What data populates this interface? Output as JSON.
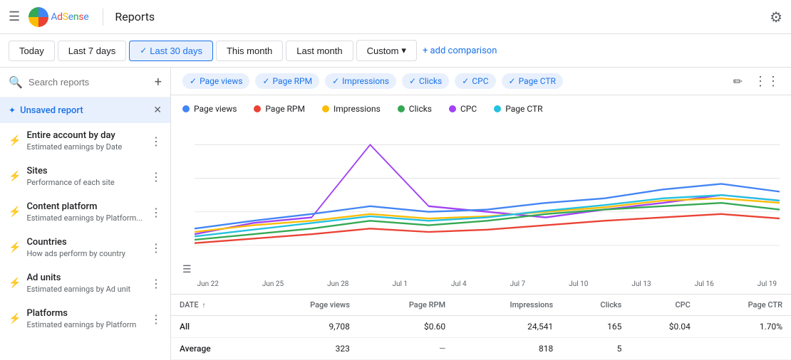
{
  "header": {
    "menu_icon": "☰",
    "logo_alt": "Google AdSense",
    "divider": true,
    "title": "Reports",
    "settings_icon": "⚙"
  },
  "date_bar": {
    "buttons": [
      {
        "label": "Today",
        "active": false
      },
      {
        "label": "Last 7 days",
        "active": false
      },
      {
        "label": "Last 30 days",
        "active": true
      },
      {
        "label": "This month",
        "active": false
      },
      {
        "label": "Last month",
        "active": false
      },
      {
        "label": "Custom",
        "active": false,
        "has_arrow": true
      }
    ],
    "add_comparison": "+ add comparison"
  },
  "sidebar": {
    "search_placeholder": "Search reports",
    "add_icon": "+",
    "unsaved_report": {
      "title": "Unsaved report",
      "close_icon": "✕"
    },
    "items": [
      {
        "id": "entire-account",
        "title": "Entire account by day",
        "subtitle": "Estimated earnings by Date",
        "has_menu": true,
        "active": false
      },
      {
        "id": "sites",
        "title": "Sites",
        "subtitle": "Performance of each site",
        "has_menu": true,
        "active": false
      },
      {
        "id": "content-platform",
        "title": "Content platform",
        "subtitle": "Estimated earnings by Platform...",
        "has_menu": true,
        "active": false
      },
      {
        "id": "countries",
        "title": "Countries",
        "subtitle": "How ads perform by country",
        "has_menu": true,
        "active": false
      },
      {
        "id": "ad-units",
        "title": "Ad units",
        "subtitle": "Estimated earnings by Ad unit",
        "has_menu": true,
        "active": false
      },
      {
        "id": "platforms",
        "title": "Platforms",
        "subtitle": "Estimated earnings by Platform",
        "has_menu": true,
        "active": false
      }
    ]
  },
  "filter_bar": {
    "chips": [
      {
        "label": "Page views",
        "color": "#4285f4"
      },
      {
        "label": "Page RPM",
        "color": "#ea4335"
      },
      {
        "label": "Impressions",
        "color": "#fbbc04"
      },
      {
        "label": "Clicks",
        "color": "#34a853"
      },
      {
        "label": "CPC",
        "color": "#a142f4"
      },
      {
        "label": "Page CTR",
        "color": "#24c1e0"
      }
    ],
    "edit_icon": "✏",
    "more_icon": "⋮"
  },
  "chart": {
    "legend": [
      {
        "label": "Page views",
        "color": "#4285f4"
      },
      {
        "label": "Page RPM",
        "color": "#ea4335"
      },
      {
        "label": "Impressions",
        "color": "#fbbc04"
      },
      {
        "label": "Clicks",
        "color": "#34a853"
      },
      {
        "label": "CPC",
        "color": "#a142f4"
      },
      {
        "label": "Page CTR",
        "color": "#24c1e0"
      }
    ],
    "x_labels": [
      "Jun 22",
      "Jun 25",
      "Jun 28",
      "Jul 1",
      "Jul 4",
      "Jul 7",
      "Jul 10",
      "Jul 13",
      "Jul 16",
      "Jul 19"
    ],
    "left_icon": "☰"
  },
  "table": {
    "columns": [
      {
        "label": "DATE",
        "sortable": true,
        "align": "left"
      },
      {
        "label": "Page views",
        "align": "right"
      },
      {
        "label": "Page RPM",
        "align": "right"
      },
      {
        "label": "Impressions",
        "align": "right"
      },
      {
        "label": "Clicks",
        "align": "right"
      },
      {
        "label": "CPC",
        "align": "right"
      },
      {
        "label": "Page CTR",
        "align": "right"
      }
    ],
    "rows": [
      {
        "date": "All",
        "page_views": "9,708",
        "page_rpm": "$0.60",
        "impressions": "24,541",
        "clicks": "165",
        "cpc": "$0.04",
        "page_ctr": "1.70%"
      },
      {
        "date": "Average",
        "page_views": "323",
        "page_rpm": "—",
        "impressions": "818",
        "clicks": "5",
        "cpc": "",
        "page_ctr": ""
      }
    ]
  }
}
